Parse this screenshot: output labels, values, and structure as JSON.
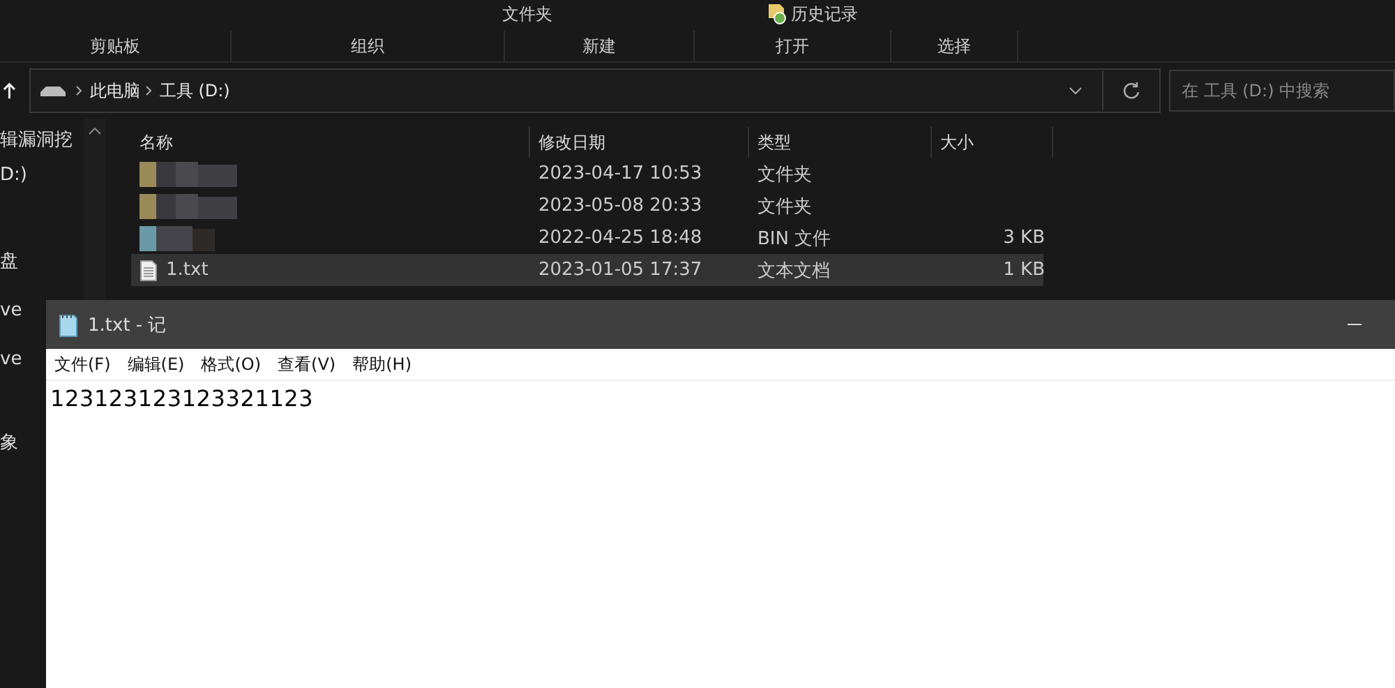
{
  "ribbon": {
    "top_items": [
      {
        "kind": "text",
        "label": "文件夹"
      },
      {
        "kind": "history",
        "label": "历史记录"
      }
    ],
    "groups": [
      "剪贴板",
      "组织",
      "新建",
      "打开",
      "选择"
    ]
  },
  "address_bar": {
    "crumbs": [
      "此电脑",
      "工具 (D:)"
    ],
    "search": {
      "placeholder": "在 工具 (D:) 中搜索"
    }
  },
  "nav_pane": {
    "items": [
      "辑漏洞挖",
      "D:)",
      "盘",
      "ve",
      "ve",
      "象"
    ]
  },
  "file_list": {
    "columns": [
      "名称",
      "修改日期",
      "类型",
      "大小"
    ],
    "rows": [
      {
        "kind": "folder",
        "name": "",
        "date": "2023-04-17 10:53",
        "type": "文件夹",
        "size": "",
        "selected": false
      },
      {
        "kind": "folder",
        "name": "",
        "date": "2023-05-08 20:33",
        "type": "文件夹",
        "size": "",
        "selected": false
      },
      {
        "kind": "bin",
        "name": "",
        "date": "2022-04-25 18:48",
        "type": "BIN 文件",
        "size": "3 KB",
        "selected": false
      },
      {
        "kind": "text",
        "name": "1.txt",
        "date": "2023-01-05 17:37",
        "type": "文本文档",
        "size": "1 KB",
        "selected": true
      }
    ]
  },
  "notepad": {
    "title": "1.txt - 记",
    "menu": [
      "文件(F)",
      "编辑(E)",
      "格式(O)",
      "查看(V)",
      "帮助(H)"
    ],
    "content": "123123123123321123"
  }
}
